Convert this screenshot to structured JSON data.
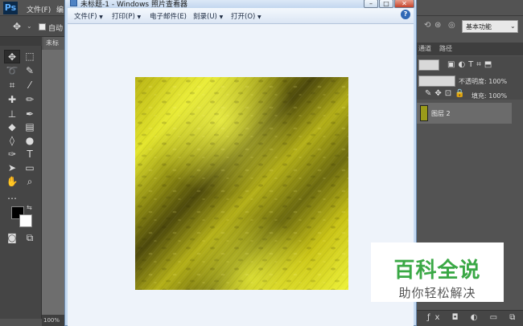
{
  "photoshop": {
    "logo": "Ps",
    "menus": [
      "文件(F)",
      "编"
    ],
    "option_bar": {
      "auto_label": "自动"
    },
    "doc_tab": "未标",
    "zoom": "100%",
    "workspace": "基本功能",
    "panel_tabs": [
      "通道",
      "路径"
    ],
    "opacity_label": "不透明度: 100%",
    "fill_label": "填充: 100%",
    "layer_name": "图层 2"
  },
  "viewer": {
    "title": "未标题-1 - Windows 照片查看器",
    "menu": [
      {
        "label": "文件(F)",
        "arrow": "▼"
      },
      {
        "label": "打印(P)",
        "arrow": "▼"
      },
      {
        "label": "电子邮件(E)",
        "arrow": ""
      },
      {
        "label": "刻录(U)",
        "arrow": "▼"
      },
      {
        "label": "打开(O)",
        "arrow": "▼"
      }
    ],
    "help": "?",
    "window_buttons": {
      "minimize": "–",
      "maximize": "□",
      "close": "✕"
    }
  },
  "watermark": {
    "title": "百科全说",
    "subtitle": "助你轻松解决",
    "color": "#3aa845"
  },
  "colors": {
    "image_base": "#c9c316",
    "image_highlight": "#eef33a",
    "image_shadow": "#4e4a0c"
  }
}
